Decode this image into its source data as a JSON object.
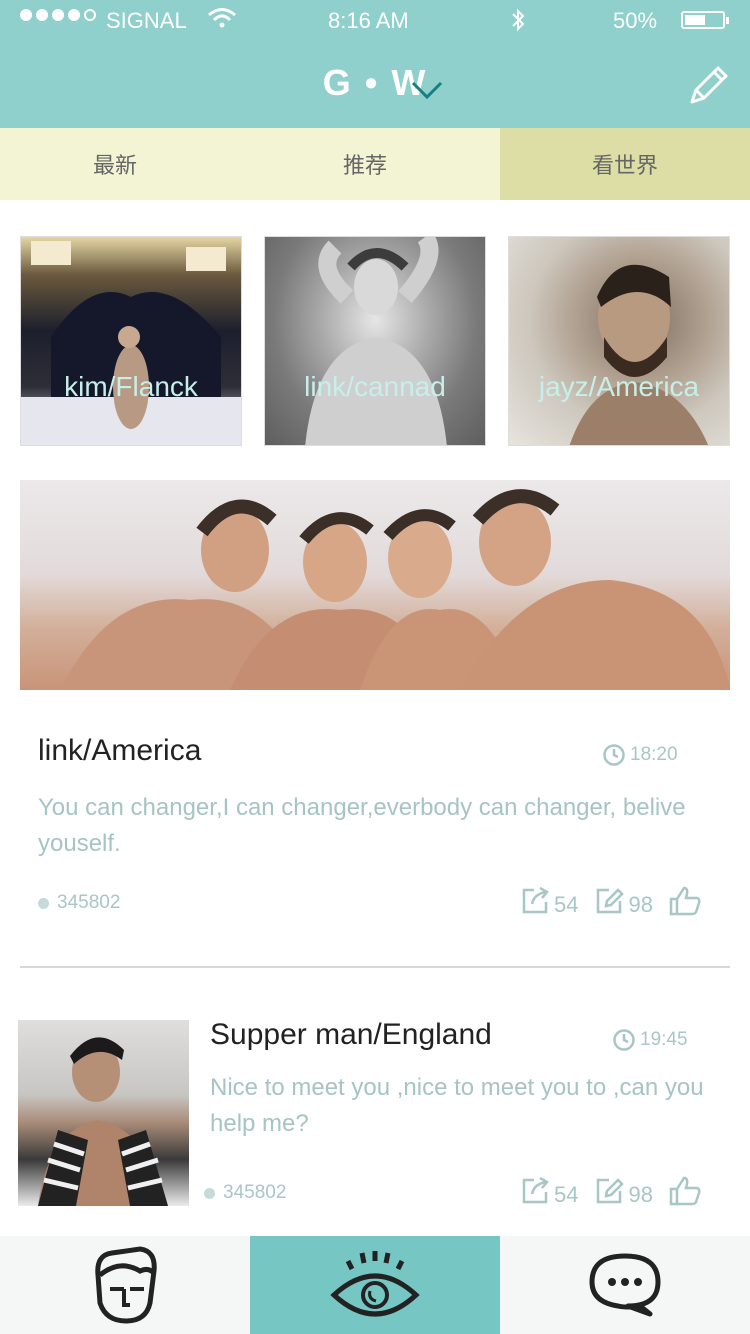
{
  "status_bar": {
    "carrier": "SIGNAL",
    "time": "8:16 AM",
    "battery": "50%",
    "battery_level": 0.5,
    "signal_bars": 4
  },
  "header": {
    "title": "G • W",
    "accent_color": "#8fcfcc"
  },
  "tabs": [
    {
      "label": "最新"
    },
    {
      "label": "推荐"
    },
    {
      "label": "看世界",
      "selected": true
    }
  ],
  "featured_users": [
    {
      "label": "kim/Flanck"
    },
    {
      "label": "link/cannad"
    },
    {
      "label": "jayz/America"
    }
  ],
  "posts": [
    {
      "title": "link/America",
      "time": "18:20",
      "text": "You can changer,I can changer,everbody can changer, belive youself.",
      "views": "345802",
      "shares": "54",
      "comments": "98"
    },
    {
      "title": "Supper man/England",
      "time": "19:45",
      "text": "Nice to meet you ,nice to meet you to ,can you help me?",
      "views": "345802",
      "shares": "54",
      "comments": "98"
    }
  ],
  "bottom_nav": [
    {
      "icon": "face-icon"
    },
    {
      "icon": "eye-icon",
      "active": true
    },
    {
      "icon": "chat-bubble-icon"
    }
  ]
}
